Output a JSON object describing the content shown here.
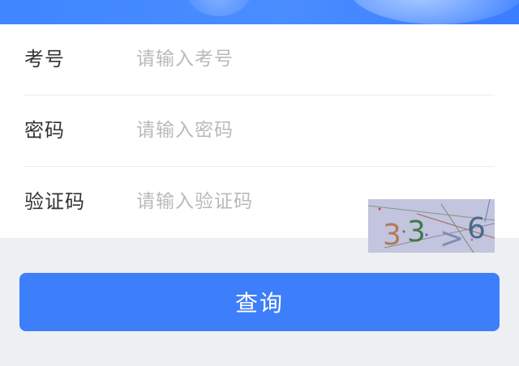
{
  "form": {
    "exam_no": {
      "label": "考号",
      "placeholder": "请输入考号",
      "value": ""
    },
    "password": {
      "label": "密码",
      "placeholder": "请输入密码",
      "value": ""
    },
    "captcha": {
      "label": "验证码",
      "placeholder": "请输入验证码",
      "value": "",
      "image_text": "33>6"
    }
  },
  "actions": {
    "submit_label": "查询"
  },
  "colors": {
    "accent": "#3d7efb",
    "banner": "#4a8dff",
    "captcha_bg": "#c3c4dd"
  }
}
